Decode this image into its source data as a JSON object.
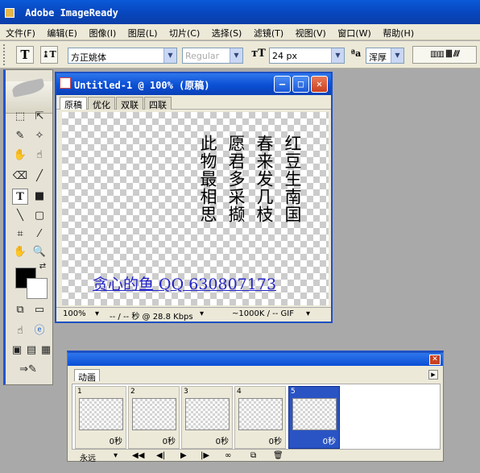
{
  "app": {
    "title": "Adobe ImageReady"
  },
  "menu": [
    "文件(F)",
    "编辑(E)",
    "图像(I)",
    "图层(L)",
    "切片(C)",
    "选择(S)",
    "滤镜(T)",
    "视图(V)",
    "窗口(W)",
    "帮助(H)"
  ],
  "options": {
    "font_family": "方正姚体",
    "font_style": "Regular",
    "font_size": "24 px",
    "antialias": "浑厚"
  },
  "document": {
    "title": "Untitled-1 @ 100% (原稿)",
    "tabs": [
      "原稿",
      "优化",
      "双联",
      "四联"
    ],
    "poem_columns": [
      "红豆生南国",
      "春来发几枝",
      "愿君多采撷",
      "此物最相思"
    ],
    "link_text": "贪心的鱼 QQ 630807173",
    "status": {
      "zoom": "100%",
      "download": "-- / -- 秒 @ 28.8 Kbps",
      "size": "~1000K / -- GIF"
    }
  },
  "animation": {
    "tab": "动画",
    "frames": [
      {
        "number": "1",
        "delay": "0秒"
      },
      {
        "number": "2",
        "delay": "0秒"
      },
      {
        "number": "3",
        "delay": "0秒"
      },
      {
        "number": "4",
        "delay": "0秒"
      },
      {
        "number": "5",
        "delay": "0秒"
      }
    ],
    "selected_frame": "5",
    "loop": "永远"
  }
}
